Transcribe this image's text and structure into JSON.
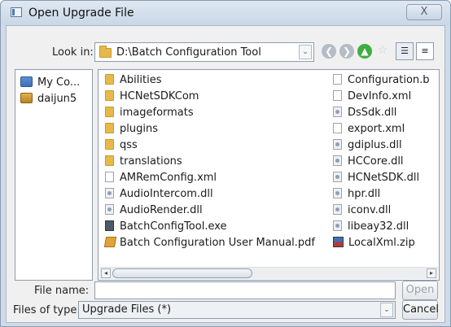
{
  "window": {
    "title": "Open Upgrade File",
    "close_label": "X"
  },
  "toolbar": {
    "look_in_label": "Look in:",
    "look_in_path": "D:\\Batch Configuration Tool",
    "combo_arrow": "⌄",
    "back_icon": "❮",
    "forward_icon": "❯",
    "up_icon": "▲",
    "new_folder_icon": "☆",
    "list_view_icon": "☰",
    "detail_view_icon": "≡"
  },
  "sidebar": {
    "items": [
      {
        "label": "My Co...",
        "icon": "computer-icon"
      },
      {
        "label": "daijun5",
        "icon": "user-folder-icon"
      }
    ]
  },
  "files": {
    "column1": [
      {
        "name": "Abilities",
        "type": "folder"
      },
      {
        "name": "HCNetSDKCom",
        "type": "folder"
      },
      {
        "name": "imageformats",
        "type": "folder"
      },
      {
        "name": "plugins",
        "type": "folder"
      },
      {
        "name": "qss",
        "type": "folder"
      },
      {
        "name": "translations",
        "type": "folder"
      },
      {
        "name": "AMRemConfig.xml",
        "type": "xml"
      },
      {
        "name": "AudioIntercom.dll",
        "type": "dll"
      },
      {
        "name": "AudioRender.dll",
        "type": "dll"
      },
      {
        "name": "BatchConfigTool.exe",
        "type": "exe"
      },
      {
        "name": "Batch Configuration User Manual.pdf",
        "type": "pdf"
      }
    ],
    "column2": [
      {
        "name": "Configuration.b",
        "type": "doc"
      },
      {
        "name": "DevInfo.xml",
        "type": "xml"
      },
      {
        "name": "DsSdk.dll",
        "type": "dll"
      },
      {
        "name": "export.xml",
        "type": "xml"
      },
      {
        "name": "gdiplus.dll",
        "type": "dll"
      },
      {
        "name": "HCCore.dll",
        "type": "dll"
      },
      {
        "name": "HCNetSDK.dll",
        "type": "dll"
      },
      {
        "name": "hpr.dll",
        "type": "dll"
      },
      {
        "name": "iconv.dll",
        "type": "dll"
      },
      {
        "name": "libeay32.dll",
        "type": "dll"
      },
      {
        "name": "LocalXml.zip",
        "type": "zip"
      }
    ]
  },
  "form": {
    "file_name_label": "File name:",
    "file_name_value": "",
    "open_label": "Open",
    "files_of_type_label": "Files of type:",
    "files_of_type_value": "Upgrade Files (*)",
    "cancel_label": "Cancel"
  },
  "scroll": {
    "left_arrow": "◂",
    "right_arrow": "▸"
  },
  "colors": {
    "accent": "#3fae3f",
    "title_bar": "#cfdbe8"
  }
}
